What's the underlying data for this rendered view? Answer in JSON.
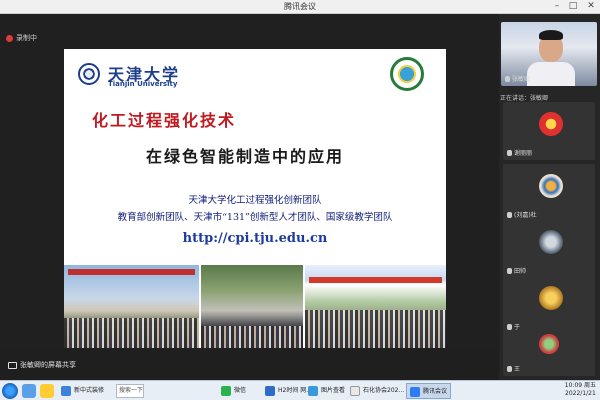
{
  "window": {
    "title": "腾讯会议"
  },
  "recording": {
    "label": "录制中"
  },
  "slide": {
    "school_cn": "天津大学",
    "school_en": "Tianjin University",
    "title_line1": "化工过程强化技术",
    "title_line2": "在绿色智能制造中的应用",
    "team_line1": "天津大学化工过程强化创新团队",
    "team_line2": "教育部创新团队、天津市“131”创新型人才团队、国家级教学团队",
    "url": "http://cpi.tju.edu.cn"
  },
  "participants": {
    "speaking_label": "正在讲话：张敏卿",
    "tiles": [
      {
        "name": "张敏卿"
      },
      {
        "name": "谢丽丽"
      },
      {
        "name": "(刘嘉)杜"
      },
      {
        "name": "田帅"
      },
      {
        "name": "于"
      },
      {
        "name": "王"
      }
    ]
  },
  "bottombar": {
    "share_label": "张敏卿的屏幕共享"
  },
  "taskbar": {
    "items": [
      {
        "label": "新中式装修"
      },
      {
        "label": "搜索一下"
      },
      {
        "label": "H2时间 网..."
      },
      {
        "label": "微信"
      },
      {
        "label": "图片查看"
      },
      {
        "label": "石化协会202..."
      },
      {
        "label": "腾讯会议"
      }
    ],
    "time": "10:09 周五",
    "date": "2022/1/21"
  },
  "colors": {
    "accent_red": "#c0191f",
    "brand_blue": "#1c3e8c",
    "rec_red": "#e03a3a"
  }
}
